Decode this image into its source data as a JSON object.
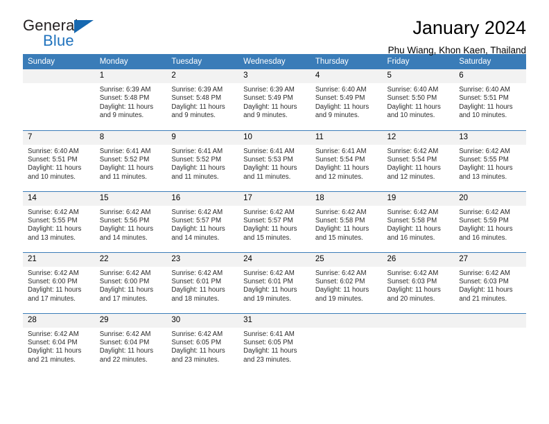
{
  "logo": {
    "word_top": "General",
    "word_bottom": "Blue",
    "triangle_color": "#1668b0"
  },
  "header": {
    "title": "January 2024",
    "subtitle": "Phu Wiang, Khon Kaen, Thailand",
    "accent_color": "#3a7cb8",
    "daynum_bg": "#f2f2f2"
  },
  "weekday_headers": [
    "Sunday",
    "Monday",
    "Tuesday",
    "Wednesday",
    "Thursday",
    "Friday",
    "Saturday"
  ],
  "labels": {
    "sunrise_prefix": "Sunrise:",
    "sunset_prefix": "Sunset:",
    "daylight_prefix": "Daylight:"
  },
  "weeks": [
    [
      {
        "day": "",
        "lines": []
      },
      {
        "day": "1",
        "lines": [
          "Sunrise: 6:39 AM",
          "Sunset: 5:48 PM",
          "Daylight: 11 hours",
          "and 9 minutes."
        ]
      },
      {
        "day": "2",
        "lines": [
          "Sunrise: 6:39 AM",
          "Sunset: 5:48 PM",
          "Daylight: 11 hours",
          "and 9 minutes."
        ]
      },
      {
        "day": "3",
        "lines": [
          "Sunrise: 6:39 AM",
          "Sunset: 5:49 PM",
          "Daylight: 11 hours",
          "and 9 minutes."
        ]
      },
      {
        "day": "4",
        "lines": [
          "Sunrise: 6:40 AM",
          "Sunset: 5:49 PM",
          "Daylight: 11 hours",
          "and 9 minutes."
        ]
      },
      {
        "day": "5",
        "lines": [
          "Sunrise: 6:40 AM",
          "Sunset: 5:50 PM",
          "Daylight: 11 hours",
          "and 10 minutes."
        ]
      },
      {
        "day": "6",
        "lines": [
          "Sunrise: 6:40 AM",
          "Sunset: 5:51 PM",
          "Daylight: 11 hours",
          "and 10 minutes."
        ]
      }
    ],
    [
      {
        "day": "7",
        "lines": [
          "Sunrise: 6:40 AM",
          "Sunset: 5:51 PM",
          "Daylight: 11 hours",
          "and 10 minutes."
        ]
      },
      {
        "day": "8",
        "lines": [
          "Sunrise: 6:41 AM",
          "Sunset: 5:52 PM",
          "Daylight: 11 hours",
          "and 11 minutes."
        ]
      },
      {
        "day": "9",
        "lines": [
          "Sunrise: 6:41 AM",
          "Sunset: 5:52 PM",
          "Daylight: 11 hours",
          "and 11 minutes."
        ]
      },
      {
        "day": "10",
        "lines": [
          "Sunrise: 6:41 AM",
          "Sunset: 5:53 PM",
          "Daylight: 11 hours",
          "and 11 minutes."
        ]
      },
      {
        "day": "11",
        "lines": [
          "Sunrise: 6:41 AM",
          "Sunset: 5:54 PM",
          "Daylight: 11 hours",
          "and 12 minutes."
        ]
      },
      {
        "day": "12",
        "lines": [
          "Sunrise: 6:42 AM",
          "Sunset: 5:54 PM",
          "Daylight: 11 hours",
          "and 12 minutes."
        ]
      },
      {
        "day": "13",
        "lines": [
          "Sunrise: 6:42 AM",
          "Sunset: 5:55 PM",
          "Daylight: 11 hours",
          "and 13 minutes."
        ]
      }
    ],
    [
      {
        "day": "14",
        "lines": [
          "Sunrise: 6:42 AM",
          "Sunset: 5:55 PM",
          "Daylight: 11 hours",
          "and 13 minutes."
        ]
      },
      {
        "day": "15",
        "lines": [
          "Sunrise: 6:42 AM",
          "Sunset: 5:56 PM",
          "Daylight: 11 hours",
          "and 14 minutes."
        ]
      },
      {
        "day": "16",
        "lines": [
          "Sunrise: 6:42 AM",
          "Sunset: 5:57 PM",
          "Daylight: 11 hours",
          "and 14 minutes."
        ]
      },
      {
        "day": "17",
        "lines": [
          "Sunrise: 6:42 AM",
          "Sunset: 5:57 PM",
          "Daylight: 11 hours",
          "and 15 minutes."
        ]
      },
      {
        "day": "18",
        "lines": [
          "Sunrise: 6:42 AM",
          "Sunset: 5:58 PM",
          "Daylight: 11 hours",
          "and 15 minutes."
        ]
      },
      {
        "day": "19",
        "lines": [
          "Sunrise: 6:42 AM",
          "Sunset: 5:58 PM",
          "Daylight: 11 hours",
          "and 16 minutes."
        ]
      },
      {
        "day": "20",
        "lines": [
          "Sunrise: 6:42 AM",
          "Sunset: 5:59 PM",
          "Daylight: 11 hours",
          "and 16 minutes."
        ]
      }
    ],
    [
      {
        "day": "21",
        "lines": [
          "Sunrise: 6:42 AM",
          "Sunset: 6:00 PM",
          "Daylight: 11 hours",
          "and 17 minutes."
        ]
      },
      {
        "day": "22",
        "lines": [
          "Sunrise: 6:42 AM",
          "Sunset: 6:00 PM",
          "Daylight: 11 hours",
          "and 17 minutes."
        ]
      },
      {
        "day": "23",
        "lines": [
          "Sunrise: 6:42 AM",
          "Sunset: 6:01 PM",
          "Daylight: 11 hours",
          "and 18 minutes."
        ]
      },
      {
        "day": "24",
        "lines": [
          "Sunrise: 6:42 AM",
          "Sunset: 6:01 PM",
          "Daylight: 11 hours",
          "and 19 minutes."
        ]
      },
      {
        "day": "25",
        "lines": [
          "Sunrise: 6:42 AM",
          "Sunset: 6:02 PM",
          "Daylight: 11 hours",
          "and 19 minutes."
        ]
      },
      {
        "day": "26",
        "lines": [
          "Sunrise: 6:42 AM",
          "Sunset: 6:03 PM",
          "Daylight: 11 hours",
          "and 20 minutes."
        ]
      },
      {
        "day": "27",
        "lines": [
          "Sunrise: 6:42 AM",
          "Sunset: 6:03 PM",
          "Daylight: 11 hours",
          "and 21 minutes."
        ]
      }
    ],
    [
      {
        "day": "28",
        "lines": [
          "Sunrise: 6:42 AM",
          "Sunset: 6:04 PM",
          "Daylight: 11 hours",
          "and 21 minutes."
        ]
      },
      {
        "day": "29",
        "lines": [
          "Sunrise: 6:42 AM",
          "Sunset: 6:04 PM",
          "Daylight: 11 hours",
          "and 22 minutes."
        ]
      },
      {
        "day": "30",
        "lines": [
          "Sunrise: 6:42 AM",
          "Sunset: 6:05 PM",
          "Daylight: 11 hours",
          "and 23 minutes."
        ]
      },
      {
        "day": "31",
        "lines": [
          "Sunrise: 6:41 AM",
          "Sunset: 6:05 PM",
          "Daylight: 11 hours",
          "and 23 minutes."
        ]
      },
      {
        "day": "",
        "lines": []
      },
      {
        "day": "",
        "lines": []
      },
      {
        "day": "",
        "lines": []
      }
    ]
  ]
}
